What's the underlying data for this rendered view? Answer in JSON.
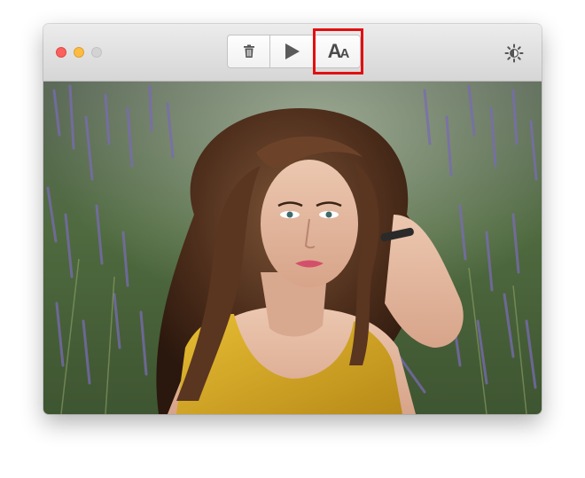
{
  "window": {
    "traffic_lights": [
      "close",
      "minimize",
      "zoom"
    ]
  },
  "toolbar": {
    "buttons": [
      {
        "name": "delete",
        "icon": "trash-icon"
      },
      {
        "name": "play",
        "icon": "play-icon"
      },
      {
        "name": "text",
        "icon": "font-size-icon",
        "glyph": "A",
        "glyph_small": "A",
        "highlighted": true
      }
    ],
    "settings_icon": "brightness-icon",
    "highlight_color": "#e20f10"
  },
  "content": {
    "image": "photo-woman-lavender-field"
  }
}
